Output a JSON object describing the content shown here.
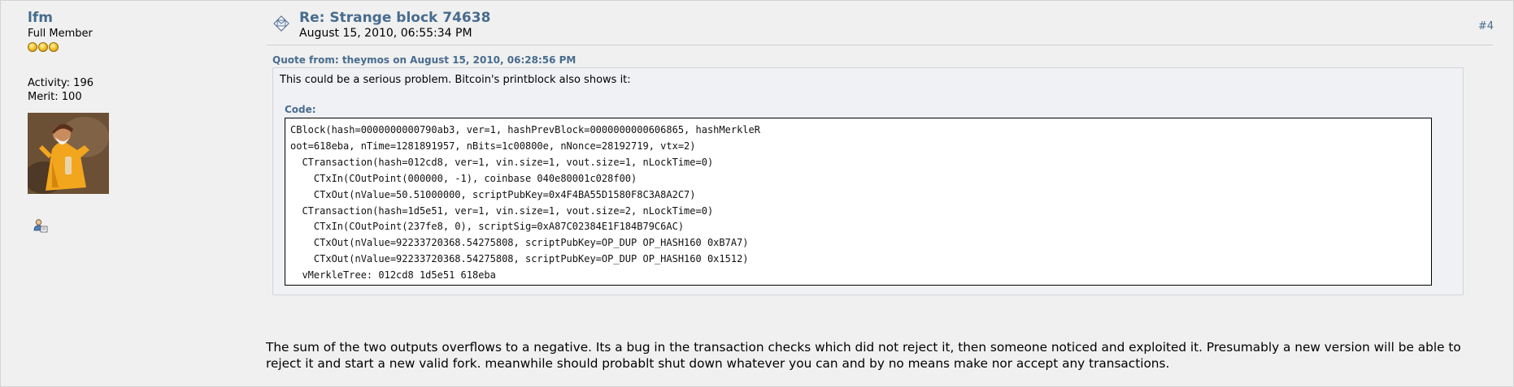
{
  "poster": {
    "name": "lfm",
    "rank": "Full Member",
    "activity": "Activity: 196",
    "merit": "Merit: 100"
  },
  "post": {
    "subject": "Re: Strange block 74638",
    "date": "August 15, 2010, 06:55:34 PM",
    "number": "#4"
  },
  "quote": {
    "header": "Quote from: theymos on August 15, 2010, 06:28:56 PM",
    "text": "This could be a serious problem. Bitcoin's printblock also shows it:",
    "code_label": "Code:",
    "code_lines": [
      "CBlock(hash=0000000000790ab3, ver=1, hashPrevBlock=0000000000606865, hashMerkleR",
      "oot=618eba, nTime=1281891957, nBits=1c00800e, nNonce=28192719, vtx=2)",
      "  CTransaction(hash=012cd8, ver=1, vin.size=1, vout.size=1, nLockTime=0)",
      "    CTxIn(COutPoint(000000, -1), coinbase 040e80001c028f00)",
      "    CTxOut(nValue=50.51000000, scriptPubKey=0x4F4BA55D1580F8C3A8A2C7)",
      "  CTransaction(hash=1d5e51, ver=1, vin.size=1, vout.size=2, nLockTime=0)",
      "    CTxIn(COutPoint(237fe8, 0), scriptSig=0xA87C02384E1F184B79C6AC)",
      "    CTxOut(nValue=92233720368.54275808, scriptPubKey=OP_DUP OP_HASH160 0xB7A7)",
      "    CTxOut(nValue=92233720368.54275808, scriptPubKey=OP_DUP OP_HASH160 0x1512)",
      "  vMerkleTree: 012cd8 1d5e51 618eba"
    ]
  },
  "body": "The sum of the two outputs overflows to a negative. Its a bug in the transaction checks which did not reject it, then someone noticed and exploited it. Presumably a new version will be able to reject it and start a new valid fork. meanwhile should probablt shut down whatever you can and by no means make nor accept any transactions.",
  "icons": {
    "rank_stars": "star-icon",
    "post_icon": "message-icon",
    "profile": "profile-icon"
  },
  "colors": {
    "link": "#476c8e",
    "background": "#f0f0f0",
    "quote_background": "#f0f1f4"
  }
}
